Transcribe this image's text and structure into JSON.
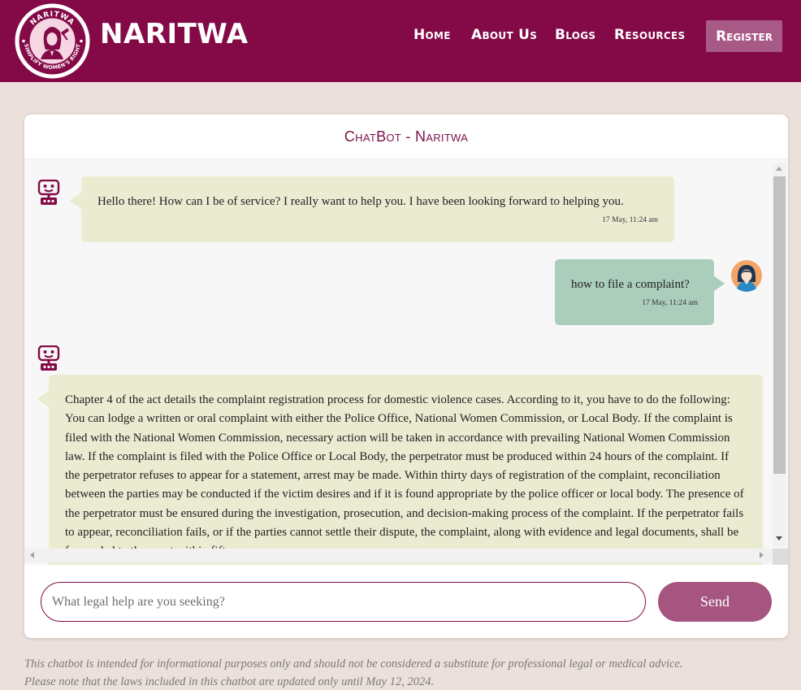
{
  "brand": {
    "name": "NARITWA",
    "logo_text_top": "NARITWA",
    "logo_text_bottom": "SIMPLIFY WOMEN'S RIGHT"
  },
  "nav": {
    "home": "Home",
    "about": "About Us",
    "blogs": "Blogs",
    "resources": "Resources",
    "register": "Register"
  },
  "chat": {
    "title": "ChatBot - Naritwa",
    "messages": [
      {
        "sender": "bot",
        "text": "Hello there! How can I be of service? I really want to help you. I have been looking forward to helping you.",
        "time": "17 May, 11:24 am"
      },
      {
        "sender": "user",
        "text": "how to file a complaint?",
        "time": "17 May, 11:24 am"
      },
      {
        "sender": "bot",
        "text": "Chapter 4 of the act details the complaint registration process for domestic violence cases. According to it, you have to do the following: You can lodge a written or oral complaint with either the Police Office, National Women Commission, or Local Body. If the complaint is filed with the National Women Commission, necessary action will be taken in accordance with prevailing National Women Commission law. If the complaint is filed with the Police Office or Local Body, the perpetrator must be produced within 24 hours of the complaint. If the perpetrator refuses to appear for a statement, arrest may be made. Within thirty days of registration of the complaint, reconciliation between the parties may be conducted if the victim desires and if it is found appropriate by the police officer or local body. The presence of the perpetrator must be ensured during the investigation, prosecution, and decision-making process of the complaint. If the perpetrator fails to appear, reconciliation fails, or if the parties cannot settle their dispute, the complaint, along with evidence and legal documents, shall be forwarded to the court within fifteen"
      }
    ],
    "input_placeholder": "What legal help are you seeking?",
    "input_value": "",
    "send_label": "Send"
  },
  "disclaimer": {
    "line1": "This chatbot is intended for informational purposes only and should not be considered a substitute for professional legal or medical advice.",
    "line2": "Please note that the laws included in this chatbot are updated only until May 12, 2024."
  },
  "colors": {
    "brand": "#840a47",
    "register_bg": "#a85a86",
    "bot_bubble": "#ebebd2",
    "user_bubble": "#abcdbc",
    "send_button": "#a5557f",
    "page_bg": "#ebe0dc"
  },
  "icons": {
    "bot": "robot-icon",
    "user": "woman-avatar-icon"
  }
}
